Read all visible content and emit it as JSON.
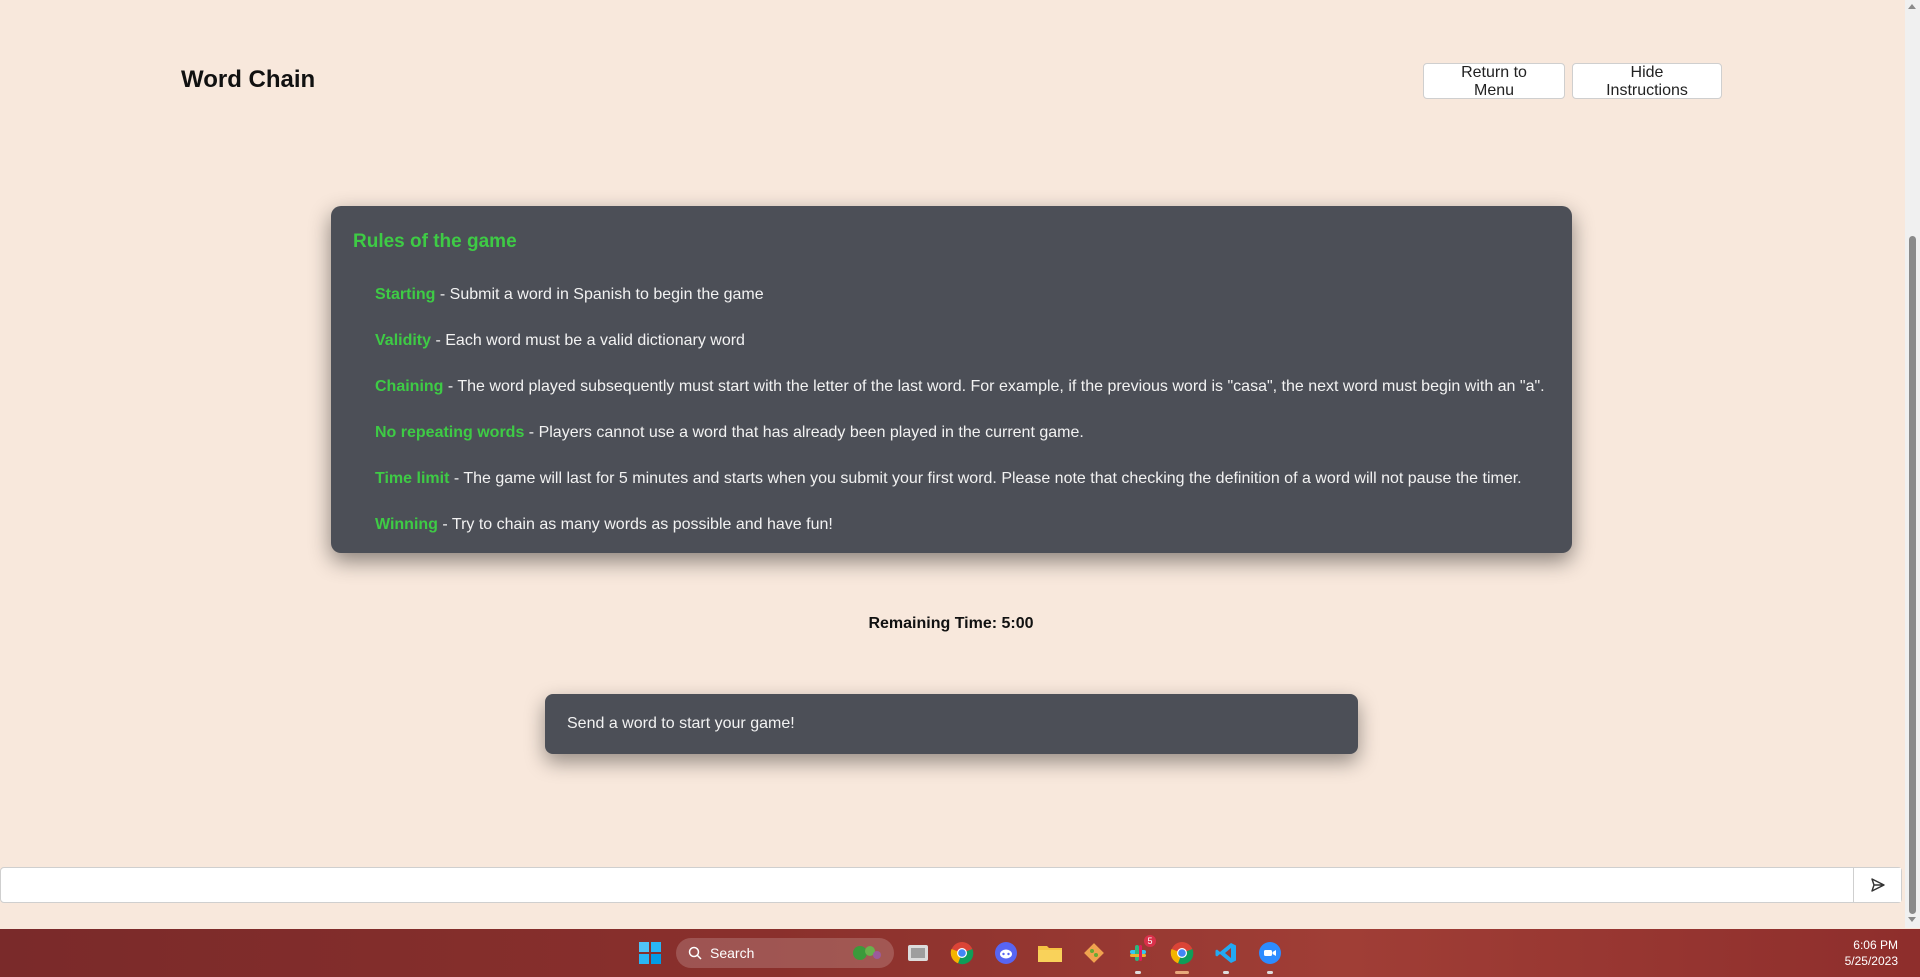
{
  "app": {
    "title": "Word Chain",
    "return_label": "Return to Menu",
    "hide_label": "Hide Instructions"
  },
  "rules": {
    "title": "Rules of the game",
    "items": [
      {
        "name": "Starting",
        "text": " - Submit a word in Spanish to begin the game"
      },
      {
        "name": "Validity",
        "text": " - Each word must be a valid dictionary word"
      },
      {
        "name": "Chaining",
        "text": " - The word played subsequently must start with the letter of the last word. For example, if the previous word is \"casa\", the next word must begin with an \"a\"."
      },
      {
        "name": "No repeating words",
        "text": " - Players cannot use a word that has already been played in the current game."
      },
      {
        "name": "Time limit",
        "text": " - The game will last for 5 minutes and starts when you submit your first word. Please note that checking the definition of a word will not pause the timer."
      },
      {
        "name": "Winning",
        "text": " - Try to chain as many words as possible and have fun!"
      }
    ],
    "accent_color": "#3ecb45"
  },
  "timer": {
    "label": "Remaining Time: 5:00"
  },
  "message": {
    "text": "Send a word to start your game!"
  },
  "input": {
    "value": "",
    "placeholder": ""
  },
  "taskbar": {
    "search_label": "Search",
    "time": "6:06 PM",
    "date": "5/25/2023",
    "slack_badge": "5",
    "icons": [
      "windows-start-icon",
      "search-icon",
      "file-explorer-icon",
      "chrome-icon",
      "discord-icon",
      "folder-icon",
      "git-icon",
      "slack-icon",
      "chrome-icon",
      "vscode-icon",
      "zoom-icon"
    ]
  }
}
